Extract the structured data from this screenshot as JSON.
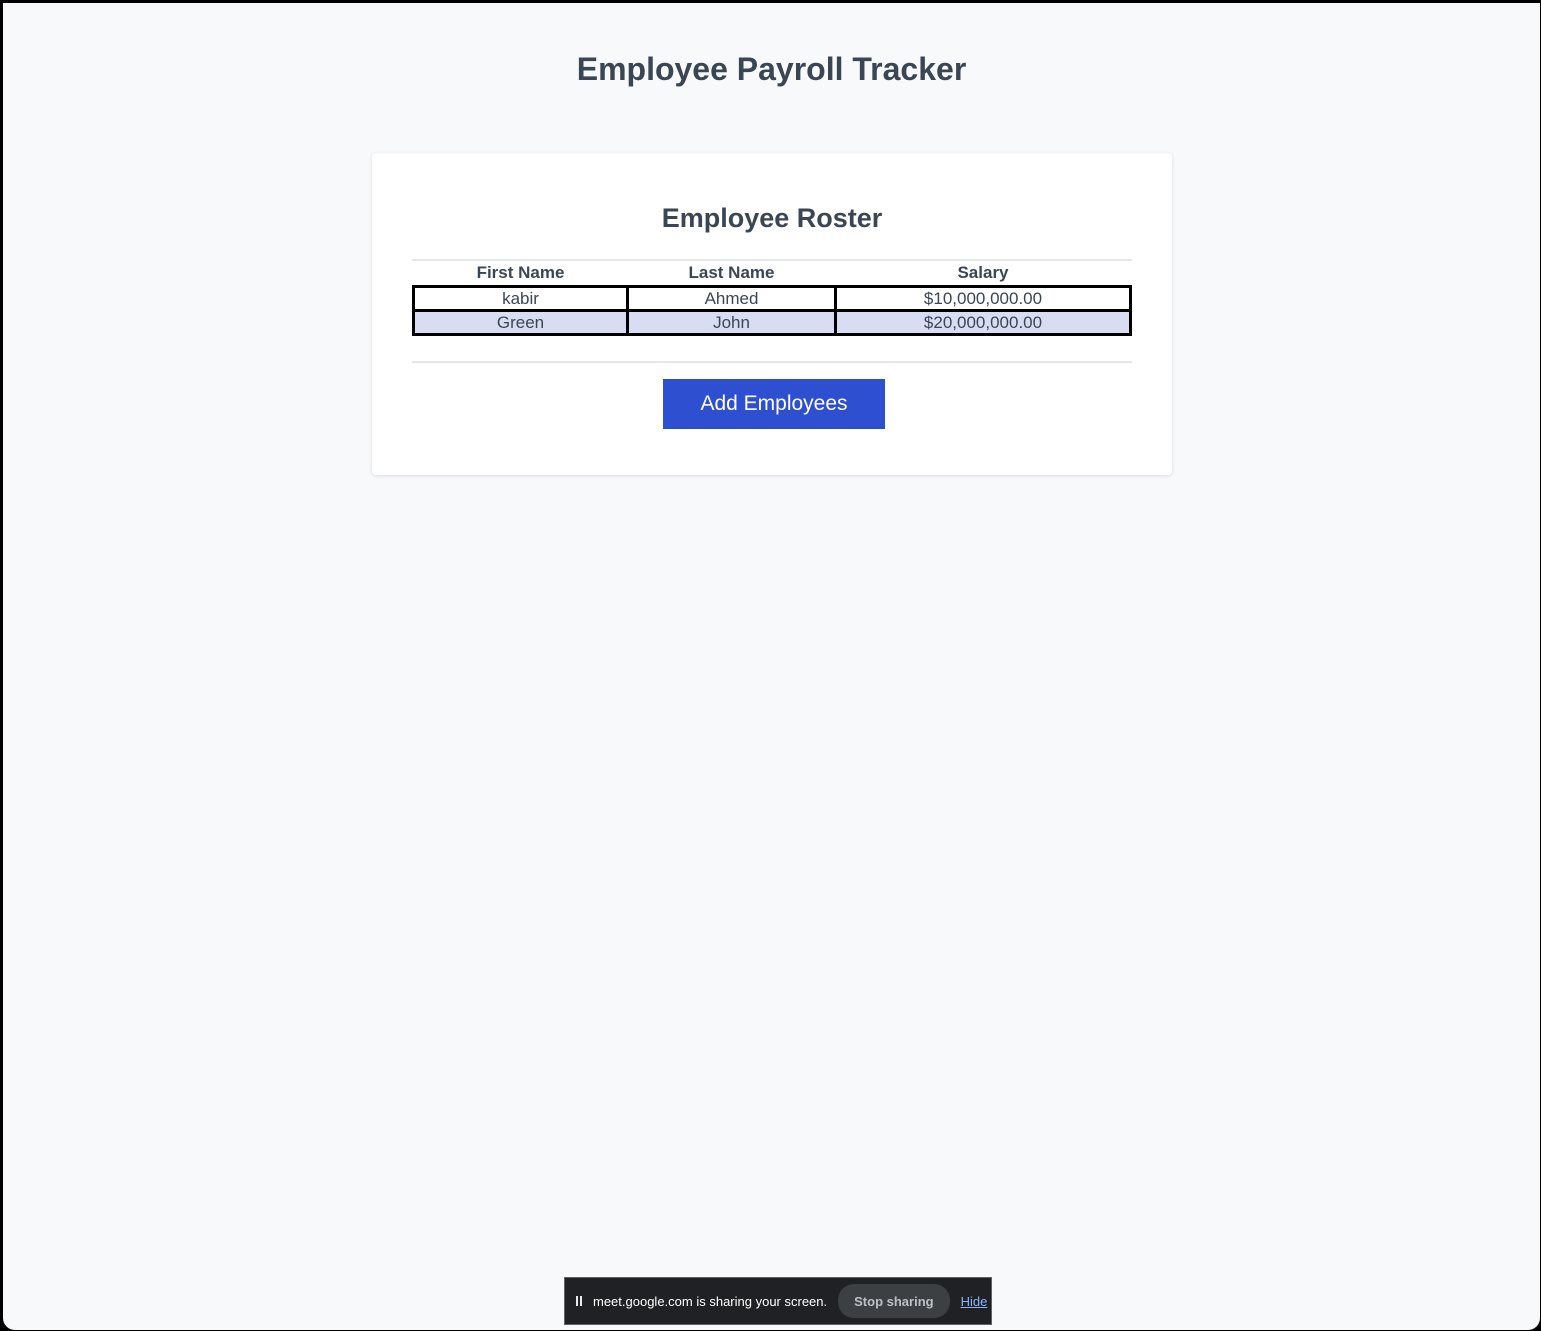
{
  "page": {
    "title": "Employee Payroll Tracker"
  },
  "roster": {
    "title": "Employee Roster",
    "columns": [
      "First Name",
      "Last Name",
      "Salary"
    ],
    "rows": [
      {
        "first": "kabir",
        "last": "Ahmed",
        "salary": "$10,000,000.00"
      },
      {
        "first": "Green",
        "last": "John",
        "salary": "$20,000,000.00"
      }
    ],
    "add_button_label": "Add Employees"
  },
  "share_bar": {
    "message": "meet.google.com is sharing your screen.",
    "stop_label": "Stop sharing",
    "hide_label": "Hide"
  },
  "colors": {
    "accent": "#2e4fd0",
    "alt_row": "#d8ddf2",
    "text": "#3b4654",
    "background": "#f8f9fb"
  }
}
